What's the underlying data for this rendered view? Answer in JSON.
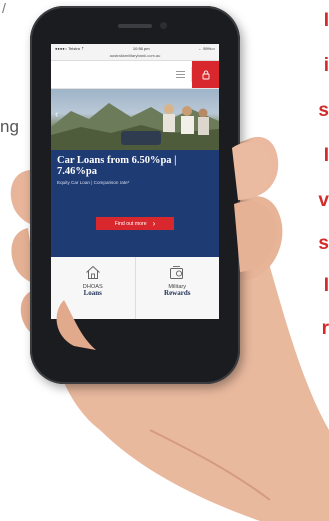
{
  "left_fragments": {
    "slash": "/",
    "ng": "ng"
  },
  "right_fragments": [
    "I",
    "i",
    "s",
    "I",
    "v",
    "s",
    "I",
    "r"
  ],
  "phone": {
    "status": {
      "carrier": "●●●●○ Telstra ⇡",
      "time": "10:56 pm",
      "battery": "← 59%▭"
    },
    "url": "australiamilitarybank.com.au",
    "header": {
      "menu_icon": "hamburger-icon",
      "login_icon": "lock-icon",
      "accent": "#d9272e"
    },
    "promo": {
      "title": "Car Loans from 6.50%pa | 7.46%pa",
      "subtitle": "Equity Car Loan  |  Comparison rate*",
      "cta": "Find out more",
      "cta_arrow": "›",
      "background": "#1f3b73"
    },
    "tiles": [
      {
        "line1": "DHOAS",
        "line2": "Loans",
        "icon": "house-icon"
      },
      {
        "line1": "Military",
        "line2": "Rewards",
        "icon": "medal-card-icon"
      }
    ]
  }
}
